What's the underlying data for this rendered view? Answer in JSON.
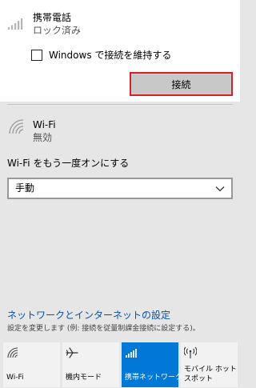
{
  "cellular": {
    "name": "携帯電話",
    "status": "ロック済み",
    "keep_connected_label": "Windows で接続を維持する",
    "keep_connected_checked": false,
    "connect_label": "接続"
  },
  "wifi": {
    "name": "Wi-Fi",
    "status": "無効",
    "turn_on_again_label": "Wi-Fi をもう一度オンにする",
    "turn_on_again_value": "手動"
  },
  "settings": {
    "link": "ネットワークとインターネットの設定",
    "description": "設定を変更します (例: 接続を従量制課金接続に設定する)。"
  },
  "tiles": [
    {
      "label": "Wi-Fi",
      "icon": "wifi-icon",
      "active": false
    },
    {
      "label": "機内モード",
      "icon": "airplane-icon",
      "active": false
    },
    {
      "label": "携帯ネットワーク",
      "icon": "cellular-signal-icon",
      "active": true
    },
    {
      "label": "モバイル ホットスポット",
      "icon": "hotspot-icon",
      "active": false
    }
  ],
  "colors": {
    "accent": "#0078d7",
    "highlight_border": "#d4202b",
    "link": "#0a4fa0"
  }
}
